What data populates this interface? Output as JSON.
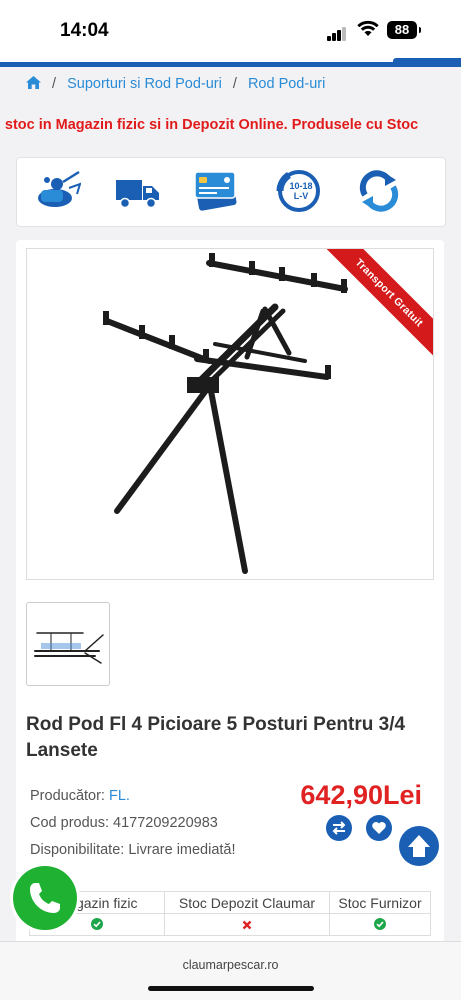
{
  "status": {
    "time": "14:04",
    "battery": "88"
  },
  "breadcrumb": {
    "items": [
      "Suporturi si Rod Pod-uri",
      "Rod Pod-uri"
    ]
  },
  "marquee": "u stoc in Magazin fizic si in Depozit Online. Produsele cu Stoc",
  "features": [
    {
      "icon": "fishing-reel-icon"
    },
    {
      "icon": "delivery-truck-icon"
    },
    {
      "icon": "payment-cards-icon"
    },
    {
      "icon": "phone-hours-icon",
      "text": "10-18 L-V"
    },
    {
      "icon": "refresh-return-icon"
    }
  ],
  "ribbon": "Transport Gratuit",
  "product": {
    "title": "Rod Pod Fl 4 Picioare 5 Posturi Pentru 3/4 Lansete",
    "producer_label": "Producător:",
    "producer": "FL.",
    "code_label": "Cod produs:",
    "code": "4177209220983",
    "availability_label": "Disponibilitate:",
    "availability": "Livrare imediată!",
    "price": "642,90Lei"
  },
  "stock_table": {
    "headers": [
      "Magazin fizic",
      "Stoc Depozit Claumar",
      "Stoc Furnizor"
    ],
    "status": [
      "yes",
      "no",
      "yes"
    ]
  },
  "colors": {
    "accent": "#1a5fb4",
    "link": "#2a8bd6",
    "price": "#e02222",
    "ok": "#1fa64a",
    "no": "#e02222",
    "phone": "#1fb132"
  },
  "browser": {
    "url": "claumarpescar.ro"
  }
}
